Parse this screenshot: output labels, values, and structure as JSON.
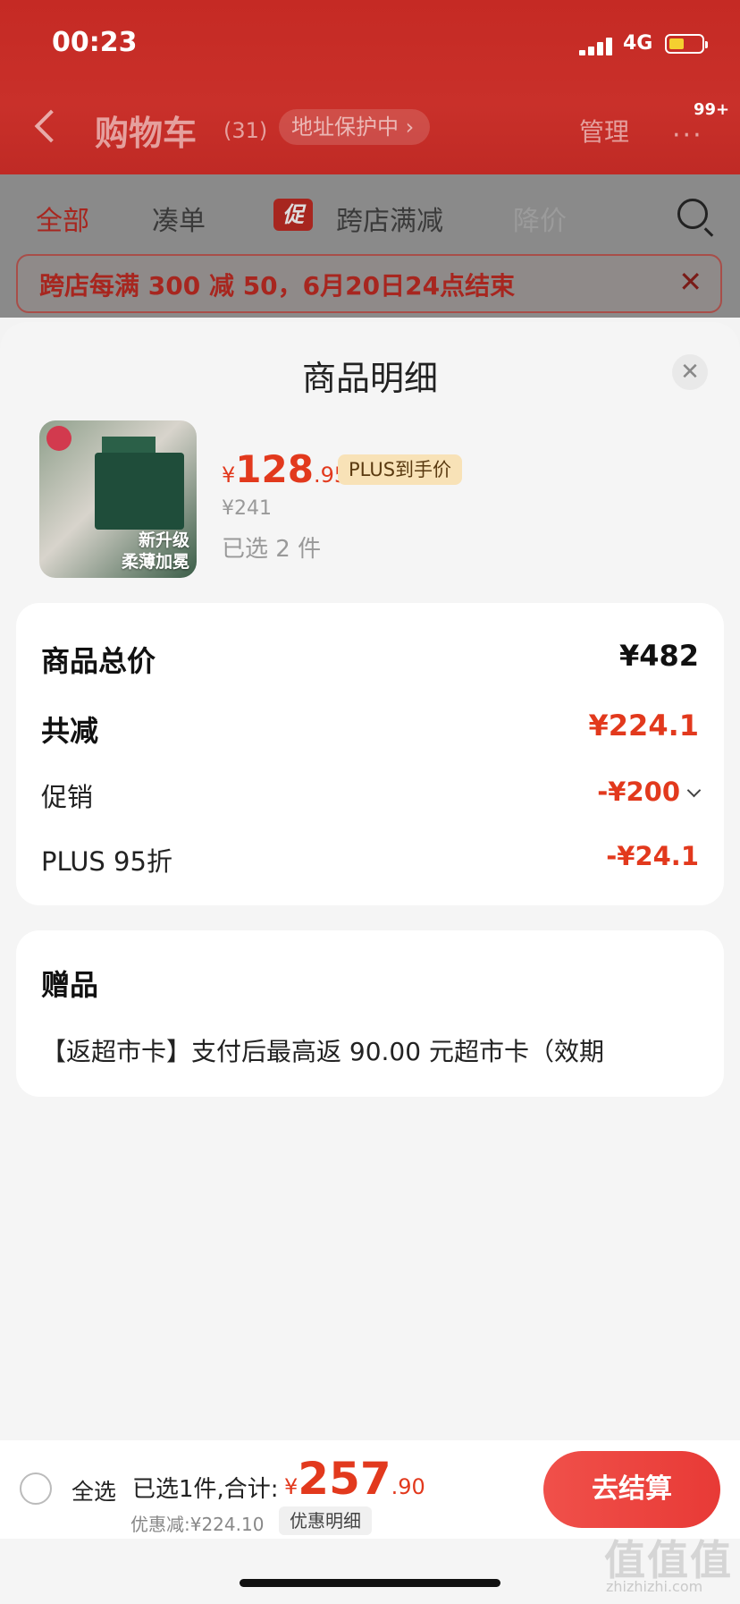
{
  "status_bar": {
    "time": "00:23",
    "network": "4G"
  },
  "header": {
    "title": "购物车",
    "count": "(31)",
    "address_pill": "地址保护中 ›",
    "manage": "管理",
    "more": "···",
    "badge": "99+"
  },
  "tabs": [
    {
      "label": "全部",
      "active": true
    },
    {
      "label": "凑单",
      "active": false
    },
    {
      "label": "跨店满减",
      "active": false
    },
    {
      "label": "降价",
      "active": false
    }
  ],
  "promo_tag": "促",
  "banner": {
    "text": "跨店每满 300 减 50，6月20日24点结束",
    "close": "✕"
  },
  "sheet": {
    "title": "商品明细",
    "close": "✕",
    "product": {
      "caption_line1": "新升级",
      "caption_line2": "柔薄加冕",
      "price_currency": "¥",
      "price_int": "128",
      "price_dec": ".95",
      "plus_tag": "PLUS到手价",
      "original_price": "¥241",
      "selected": "已选 2 件"
    },
    "summary": {
      "total_label": "商品总价",
      "total_value": "¥482",
      "reduce_label": "共减",
      "reduce_value": "¥224.1",
      "promo_label": "促销",
      "promo_value": "-¥200",
      "plus_label": "PLUS 95折",
      "plus_value": "-¥24.1"
    },
    "gift": {
      "title": "赠品",
      "text": "【返超市卡】支付后最高返 90.00 元超市卡（效期"
    }
  },
  "bottom": {
    "select_all": "全选",
    "summary_label": "已选1件,合计:",
    "total_currency": "¥",
    "total_int": "257",
    "total_dec": ".90",
    "discount": "优惠减:¥224.10",
    "detail_button": "优惠明细",
    "checkout": "去结算"
  },
  "watermark": {
    "logo": "值值值",
    "url": "zhizhizhi.com"
  },
  "colors": {
    "accent_red": "#e2391d",
    "header_red": "#c52a24",
    "plus_gold": "#f8e2b7"
  }
}
